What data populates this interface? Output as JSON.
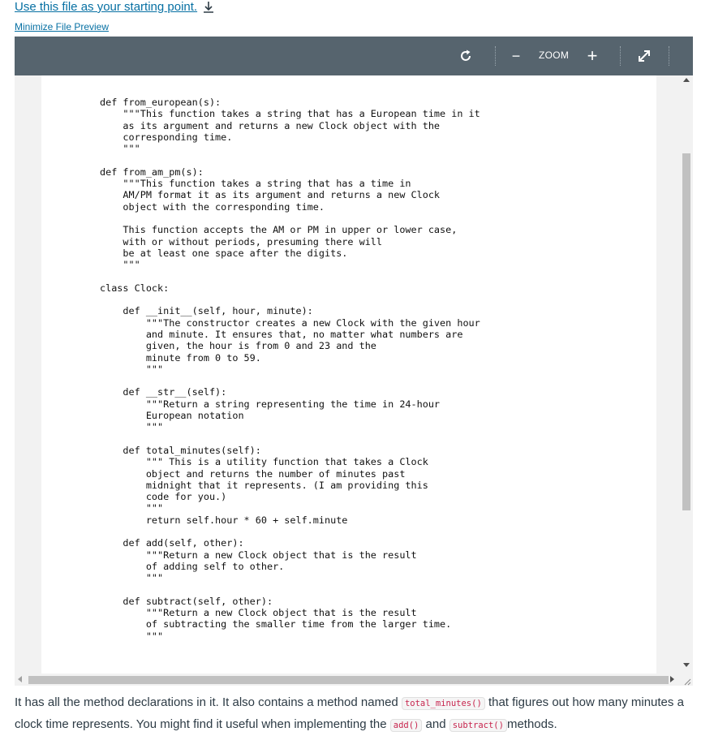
{
  "header": {
    "starting_point_link": "Use this file as your starting point.",
    "minimize_link": "Minimize File Preview"
  },
  "toolbar": {
    "zoom_label": "ZOOM",
    "minus_symbol": "−",
    "plus_symbol": "+"
  },
  "document": {
    "code": "def from_european(s):\n    \"\"\"This function takes a string that has a European time in it\n    as its argument and returns a new Clock object with the\n    corresponding time.\n    \"\"\"\n\ndef from_am_pm(s):\n    \"\"\"This function takes a string that has a time in\n    AM/PM format it as its argument and returns a new Clock\n    object with the corresponding time.\n\n    This function accepts the AM or PM in upper or lower case,\n    with or without periods, presuming there will\n    be at least one space after the digits.\n    \"\"\"\n\nclass Clock:\n\n    def __init__(self, hour, minute):\n        \"\"\"The constructor creates a new Clock with the given hour\n        and minute. It ensures that, no matter what numbers are\n        given, the hour is from 0 and 23 and the\n        minute from 0 to 59.\n        \"\"\"\n\n    def __str__(self):\n        \"\"\"Return a string representing the time in 24-hour\n        European notation\n        \"\"\"\n\n    def total_minutes(self):\n        \"\"\" This is a utility function that takes a Clock\n        object and returns the number of minutes past\n        midnight that it represents. (I am providing this\n        code for you.)\n        \"\"\"\n        return self.hour * 60 + self.minute\n\n    def add(self, other):\n        \"\"\"Return a new Clock object that is the result\n        of adding self to other.\n        \"\"\"\n\n    def subtract(self, other):\n        \"\"\"Return a new Clock object that is the result\n        of subtracting the smaller time from the larger time.\n        \"\"\""
  },
  "description": {
    "part1": "It has all the method declarations in it. It also contains a method named ",
    "code1": "total_minutes()",
    "part2": " that figures out how many minutes a clock time represents. You might find it useful when implementing the ",
    "code2": "add()",
    "part3": " and ",
    "code3": "subtract()",
    "part4": "methods."
  },
  "icons": {
    "download": "download-icon",
    "rotate": "rotate-icon",
    "zoom_out": "minus-icon",
    "zoom_in": "plus-icon",
    "fullscreen": "fullscreen-icon"
  },
  "colors": {
    "toolbar_bg": "#56646e",
    "link": "#0770a3",
    "code_chip": "#c7254e"
  }
}
